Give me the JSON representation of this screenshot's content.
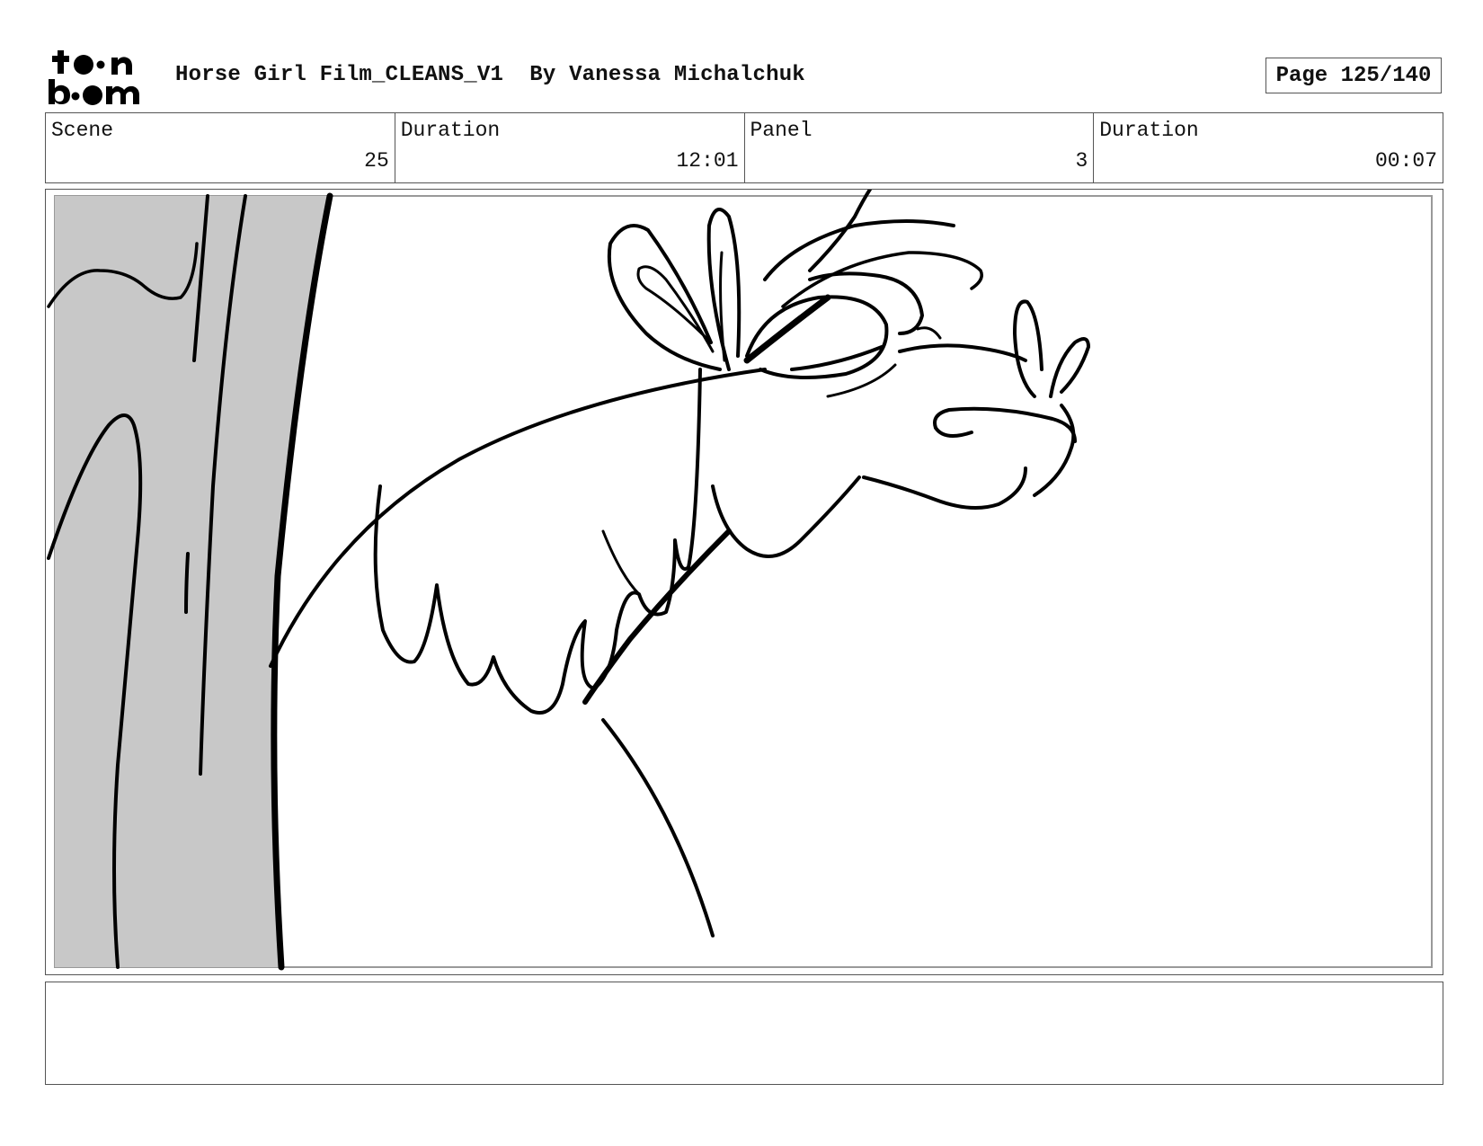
{
  "header": {
    "logo_text": "toon boom",
    "title": "Horse Girl Film_CLEANS_V1  By Vanessa Michalchuk",
    "page": "Page 125/140"
  },
  "info": [
    {
      "label": "Scene",
      "value": "25"
    },
    {
      "label": "Duration",
      "value": "12:01"
    },
    {
      "label": "Panel",
      "value": "3"
    },
    {
      "label": "Duration",
      "value": "00:07"
    }
  ],
  "notes": {
    "text": ""
  },
  "colors": {
    "tree_fill": "#c8c8c8",
    "ink": "#000000",
    "border": "#555555"
  }
}
